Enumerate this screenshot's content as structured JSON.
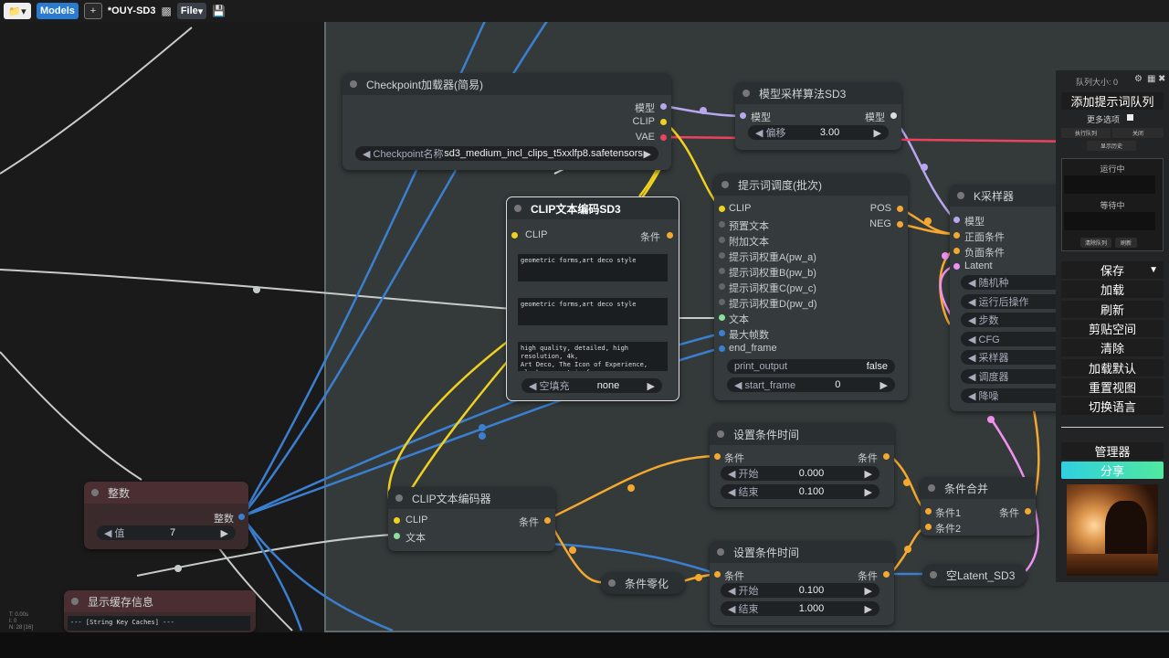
{
  "topbar": {
    "models_label": "Models",
    "plus_label": "+",
    "title": "*OUY-SD3",
    "file_label": "File"
  },
  "nodes": {
    "checkpoint": {
      "title": "Checkpoint加载器(简易)",
      "out_model": "模型",
      "out_clip": "CLIP",
      "out_vae": "VAE",
      "w_label": "Checkpoint名称",
      "w_value": "sd3_medium_incl_clips_t5xxlfp8.safetensors"
    },
    "modelsampling": {
      "title": "模型采样算法SD3",
      "in_model": "模型",
      "out_model": "模型",
      "w_label": "偏移",
      "w_value": "3.00"
    },
    "clip_sd3": {
      "title": "CLIP文本编码SD3",
      "in_clip": "CLIP",
      "out_cond": "条件",
      "text1": "geometric forms,art deco style",
      "text2": "geometric forms,art deco style",
      "text3": "high quality, detailed, high resolution, 4k,\nArt Deco, The Icon of Experience, sleek, geometric forms",
      "w_label": "空填充",
      "w_value": "none"
    },
    "prompt_sched": {
      "title": "提示词调度(批次)",
      "in_clip": "CLIP",
      "out_pos": "POS",
      "out_neg": "NEG",
      "in_pre": "预置文本",
      "in_app": "附加文本",
      "in_a": "提示词权重A(pw_a)",
      "in_b": "提示词权重B(pw_b)",
      "in_c": "提示词权重C(pw_c)",
      "in_d": "提示词权重D(pw_d)",
      "in_text": "文本",
      "in_maxf": "最大帧数",
      "in_end": "end_frame",
      "w1_label": "print_output",
      "w1_value": "false",
      "w2_label": "start_frame",
      "w2_value": "0"
    },
    "ksampler": {
      "title": "K采样器",
      "in_model": "模型",
      "in_pos": "正面条件",
      "in_neg": "负面条件",
      "in_latent": "Latent",
      "w1": "随机种",
      "w2": "运行后操作",
      "w3": "步数",
      "w4": "CFG",
      "w5": "采样器",
      "w6": "调度器",
      "w7": "降噪"
    },
    "int": {
      "title": "整数",
      "out": "整数",
      "w_label": "值",
      "w_value": "7"
    },
    "clip_enc": {
      "title": "CLIP文本编码器",
      "in_clip": "CLIP",
      "in_text": "文本",
      "out": "条件"
    },
    "cond_time1": {
      "title": "设置条件时间",
      "in": "条件",
      "out": "条件",
      "w1_label": "开始",
      "w1_value": "0.000",
      "w2_label": "结束",
      "w2_value": "0.100"
    },
    "cond_time2": {
      "title": "设置条件时间",
      "in": "条件",
      "out": "条件",
      "w1_label": "开始",
      "w1_value": "0.100",
      "w2_label": "结束",
      "w2_value": "1.000"
    },
    "cond_combine": {
      "title": "条件合并",
      "in1": "条件1",
      "in2": "条件2",
      "out": "条件"
    },
    "cond_zero": {
      "title": "条件零化"
    },
    "empty_latent": {
      "title": "空Latent_SD3"
    },
    "cache": {
      "title": "显示缓存信息",
      "text": "--- [String Key Caches] ---"
    }
  },
  "panel": {
    "queue_size": "队列大小: 0",
    "add_queue": "添加提示词队列",
    "more_options": "更多选项",
    "small1": "执行队列",
    "small2": "关闭",
    "small3": "显示历史",
    "running": "运行中",
    "waiting": "等待中",
    "clear_queue": "清除队列",
    "refresh_small": "刷新",
    "save": "保存",
    "load": "加载",
    "refresh": "刷新",
    "clipspace": "剪贴空间",
    "clear": "清除",
    "load_default": "加载默认",
    "reset_view": "重置视图",
    "switch_lang": "切换语言",
    "manage": "管理器",
    "share": "分享"
  },
  "stats": {
    "line1": "T: 0.00s",
    "line2": "I: 0",
    "line3": "N: 28 [16]"
  },
  "colors": {
    "clip": "#f0d020",
    "model": "#b8a7ef",
    "vae": "#f04060",
    "cond": "#f4a830",
    "int": "#3b7fd0",
    "text": "#8ce09a",
    "latent": "#f090f0"
  }
}
